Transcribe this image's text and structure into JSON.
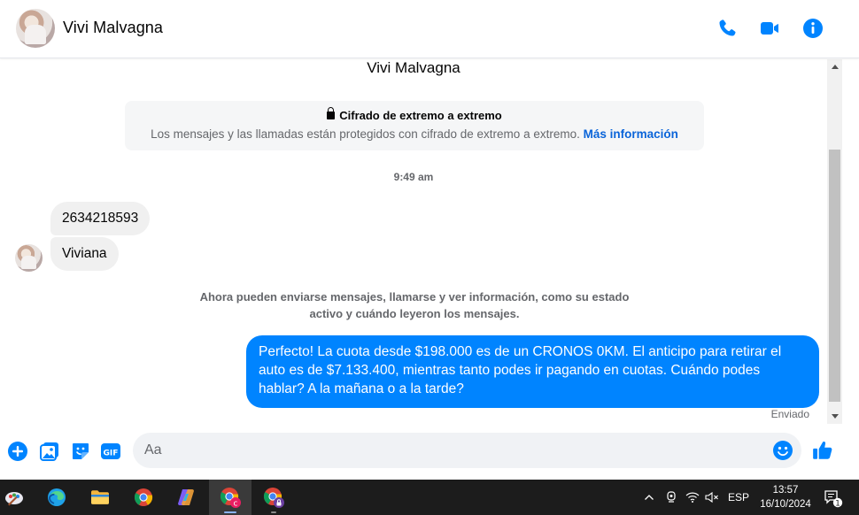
{
  "contact": {
    "name": "Vivi Malvagna"
  },
  "header": {
    "call_icon": "phone-icon",
    "video_icon": "video-camera-icon",
    "info_icon": "info-icon",
    "accent_color": "#0084ff"
  },
  "conversation": {
    "title": "Vivi Malvagna",
    "encryption": {
      "title": "Cifrado de extremo a extremo",
      "description": "Los mensajes y las llamadas están protegidos con cifrado de extremo a extremo.",
      "link": "Más información"
    },
    "time_separator": "9:49 am",
    "incoming": [
      {
        "text": "2634218593"
      },
      {
        "text": "Viviana"
      }
    ],
    "notice": "Ahora pueden enviarse mensajes, llamarse y ver información, como su estado activo y cuándo leyeron los mensajes.",
    "outgoing": {
      "text": "Perfecto! La cuota desde $198.000 es de un CRONOS 0KM. El anticipo para retirar el auto es de $7.133.400, mientras tanto podes ir pagando en cuotas. Cuándo podes hablar? A la mañana o a la tarde?",
      "status": "Enviado"
    }
  },
  "composer": {
    "placeholder": "Aa",
    "icons": [
      "plus-circle-icon",
      "photo-icon",
      "sticker-icon",
      "gif-icon",
      "emoji-icon",
      "thumbs-up-icon"
    ],
    "gif_label": "GIF"
  },
  "taskbar": {
    "apps": [
      "paint-icon",
      "edge-icon",
      "file-explorer-icon",
      "chrome-icon",
      "copilot-icon",
      "chrome-profile-c-icon",
      "chrome-profile-lock-icon"
    ],
    "language": "ESP",
    "time": "13:57",
    "date": "16/10/2024",
    "notification_count": "1"
  }
}
